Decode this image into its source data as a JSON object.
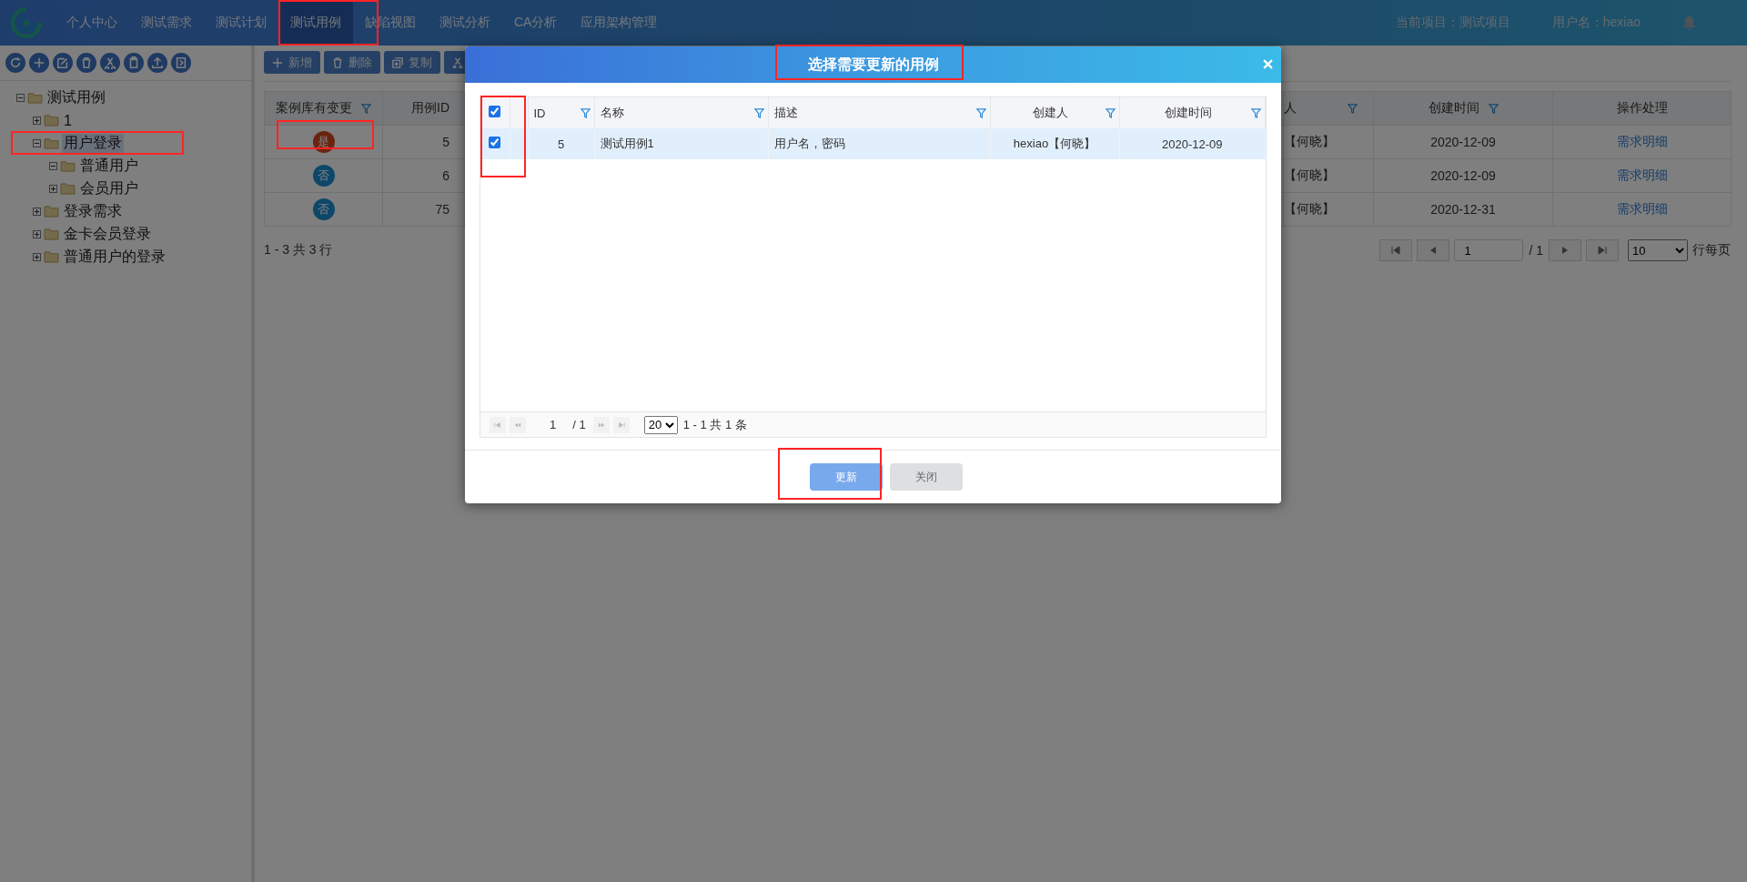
{
  "nav": {
    "items": [
      {
        "label": "个人中心",
        "selected": false
      },
      {
        "label": "测试需求",
        "selected": false
      },
      {
        "label": "测试计划",
        "selected": false
      },
      {
        "label": "测试用例",
        "selected": true
      },
      {
        "label": "缺陷视图",
        "selected": false
      },
      {
        "label": "测试分析",
        "selected": false
      },
      {
        "label": "CA分析",
        "selected": false
      },
      {
        "label": "应用架构管理",
        "selected": false
      }
    ],
    "project": "当前项目：测试项目",
    "user": "用户名：hexiao"
  },
  "tree_toolbar": [
    {
      "kind": "refresh"
    },
    {
      "kind": "add"
    },
    {
      "kind": "edit"
    },
    {
      "kind": "delete"
    },
    {
      "kind": "cut"
    },
    {
      "kind": "paste"
    },
    {
      "kind": "upload"
    },
    {
      "kind": "export"
    }
  ],
  "tree": [
    {
      "label": "测试用例",
      "expanded": true,
      "selected": false,
      "children": [
        {
          "label": "1",
          "expanded": false,
          "selected": false
        },
        {
          "label": "用户登录",
          "expanded": true,
          "selected": true,
          "children": [
            {
              "label": "普通用户",
              "expanded": true,
              "selected": false
            },
            {
              "label": "会员用户",
              "expanded": false,
              "selected": false
            }
          ]
        },
        {
          "label": "登录需求",
          "expanded": false,
          "selected": false
        },
        {
          "label": "金卡会员登录",
          "expanded": false,
          "selected": false
        },
        {
          "label": "普通用户的登录",
          "expanded": false,
          "selected": false
        }
      ]
    }
  ],
  "toolbar": [
    {
      "kind": "add",
      "label": "新增"
    },
    {
      "kind": "delete",
      "label": "删除"
    },
    {
      "kind": "copy",
      "label": "复制"
    },
    {
      "kind": "cut"
    }
  ],
  "table": {
    "columns": [
      {
        "label": "案例库有变更",
        "filter": true
      },
      {
        "label": "用例ID",
        "filter": false
      },
      {
        "label": "人",
        "filter": true
      },
      {
        "label": "创建时间",
        "filter": true
      },
      {
        "label": "操作处理",
        "filter": false
      }
    ],
    "rows": [
      {
        "changed": true,
        "flag": "是",
        "id": "5",
        "creator": "【何晓】",
        "created": "2020-12-09",
        "action": "需求明细"
      },
      {
        "changed": false,
        "flag": "否",
        "id": "6",
        "creator": "【何晓】",
        "created": "2020-12-09",
        "action": "需求明细"
      },
      {
        "changed": false,
        "flag": "否",
        "id": "75",
        "creator": "【何晓】",
        "created": "2020-12-31",
        "action": "需求明细"
      }
    ],
    "summary": "1 - 3 共 3 行",
    "pager": {
      "page": "1",
      "total": "/ 1",
      "page_size": "10",
      "per_page": "行每页"
    }
  },
  "dialog": {
    "title": "选择需要更新的用例",
    "all_checked": true,
    "columns": [
      {
        "label": "ID",
        "filter": true
      },
      {
        "label": "名称",
        "filter": true
      },
      {
        "label": "描述",
        "filter": true
      },
      {
        "label": "创建人",
        "filter": true
      },
      {
        "label": "创建时间",
        "filter": true
      }
    ],
    "rows": [
      {
        "checked": true,
        "selected": true,
        "id": "5",
        "name": "测试用例1",
        "desc": "用户名，密码",
        "creator": "hexiao【何晓】",
        "created": "2020-12-09"
      }
    ],
    "pager": {
      "page": "1",
      "total": "/ 1",
      "page_size": "20",
      "summary": "1 - 1 共 1 条"
    },
    "buttons": [
      {
        "kind": "primary",
        "label": "更新"
      },
      {
        "kind": "secondary",
        "label": "关闭"
      }
    ]
  }
}
